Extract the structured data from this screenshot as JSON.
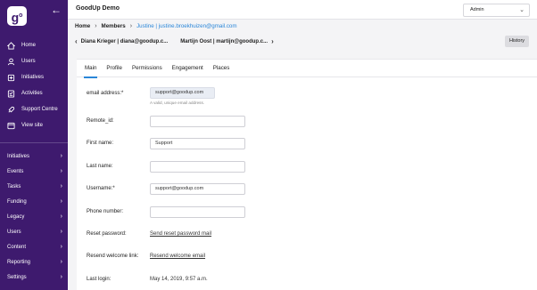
{
  "app": {
    "title": "GoodUp Demo"
  },
  "role_select": {
    "value": "Admin"
  },
  "sidebar": {
    "top_items": [
      {
        "label": "Home",
        "icon": "home-icon"
      },
      {
        "label": "Users",
        "icon": "user-icon"
      },
      {
        "label": "Initiatives",
        "icon": "bulb-icon"
      },
      {
        "label": "Activities",
        "icon": "checklist-icon"
      },
      {
        "label": "Support Centre",
        "icon": "rocket-icon"
      },
      {
        "label": "View site",
        "icon": "window-icon"
      }
    ],
    "bottom_items": [
      {
        "label": "Initiatives"
      },
      {
        "label": "Events"
      },
      {
        "label": "Tasks"
      },
      {
        "label": "Funding"
      },
      {
        "label": "Legacy"
      },
      {
        "label": "Users"
      },
      {
        "label": "Content"
      },
      {
        "label": "Reporting"
      },
      {
        "label": "Settings"
      }
    ]
  },
  "breadcrumb": {
    "items": [
      "Home",
      "Members"
    ],
    "current": "Justine | justine.broekhuizen@gmail.com"
  },
  "sibling_nav": {
    "prev": "Diana Krieger | diana@goodup.c...",
    "next": "Martijn Oost | martijn@goodup.c..."
  },
  "history_button": "History",
  "tabs": [
    "Main",
    "Profile",
    "Permissions",
    "Engagement",
    "Places"
  ],
  "form": {
    "email": {
      "label": "email address:*",
      "value": "support@goodup.com",
      "hint": "A valid, unique email address."
    },
    "remote_id": {
      "label": "Remote_id:",
      "value": ""
    },
    "first_name": {
      "label": "First name:",
      "value": "Support"
    },
    "last_name": {
      "label": "Last name:",
      "value": ""
    },
    "username": {
      "label": "Username:*",
      "value": "support@goodup.com"
    },
    "phone": {
      "label": "Phone number:",
      "value": ""
    },
    "reset_password": {
      "label": "Reset password:",
      "link": "Send reset password mail"
    },
    "resend_welcome": {
      "label": "Resend welcome link:",
      "link": "Resend welcome email"
    },
    "last_login": {
      "label": "Last login:",
      "value": "May 14, 2019, 9:57 a.m."
    }
  }
}
